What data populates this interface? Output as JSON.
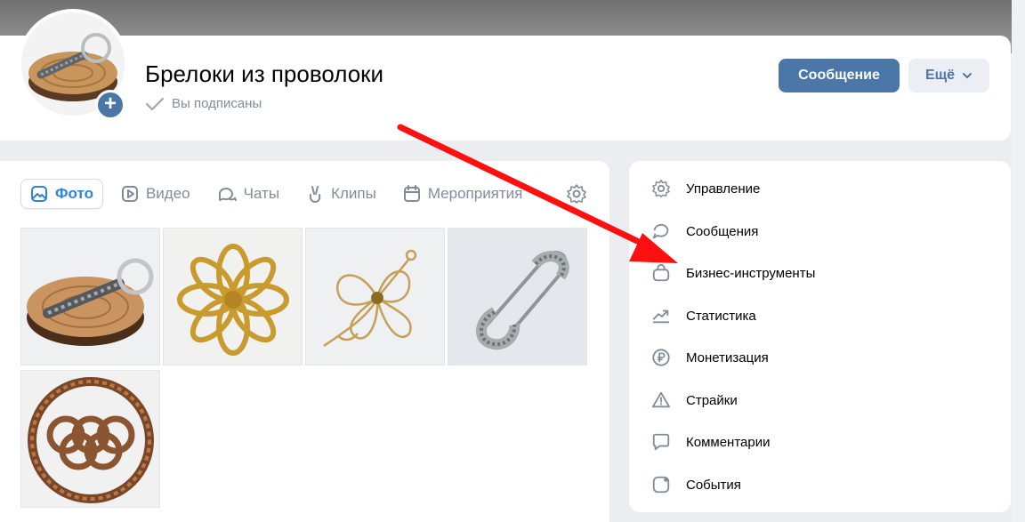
{
  "group": {
    "title": "Брелоки из проволоки",
    "subscribed_label": "Вы подписаны",
    "avatar_add": "+"
  },
  "actions": {
    "message_label": "Сообщение",
    "more_label": "Ещё"
  },
  "tabs": [
    {
      "label": "Фото",
      "icon": "photo-icon",
      "active": true
    },
    {
      "label": "Видео",
      "icon": "video-icon"
    },
    {
      "label": "Чаты",
      "icon": "chats-icon"
    },
    {
      "label": "Клипы",
      "icon": "clips-icon"
    },
    {
      "label": "Мероприятия",
      "icon": "calendar-icon"
    }
  ],
  "photos": [
    {
      "subject": "keychain on wood slice"
    },
    {
      "subject": "gold wire flower"
    },
    {
      "subject": "gold filigree flower"
    },
    {
      "subject": "silver safety pin"
    },
    {
      "subject": "copper rope rings"
    }
  ],
  "sidebar": {
    "items": [
      {
        "label": "Управление",
        "icon": "gear-icon"
      },
      {
        "label": "Сообщения",
        "icon": "message-icon"
      },
      {
        "label": "Бизнес-инструменты",
        "icon": "bag-icon"
      },
      {
        "label": "Статистика",
        "icon": "chart-icon"
      },
      {
        "label": "Монетизация",
        "icon": "ruble-icon"
      },
      {
        "label": "Страйки",
        "icon": "warning-icon"
      },
      {
        "label": "Комментарии",
        "icon": "comment-icon"
      },
      {
        "label": "События",
        "icon": "event-icon"
      }
    ]
  },
  "colors": {
    "accent": "#4a76a8",
    "active_tab": "#2d81e0",
    "secondary_text": "#818c99",
    "annotation_arrow": "#ff1010"
  }
}
